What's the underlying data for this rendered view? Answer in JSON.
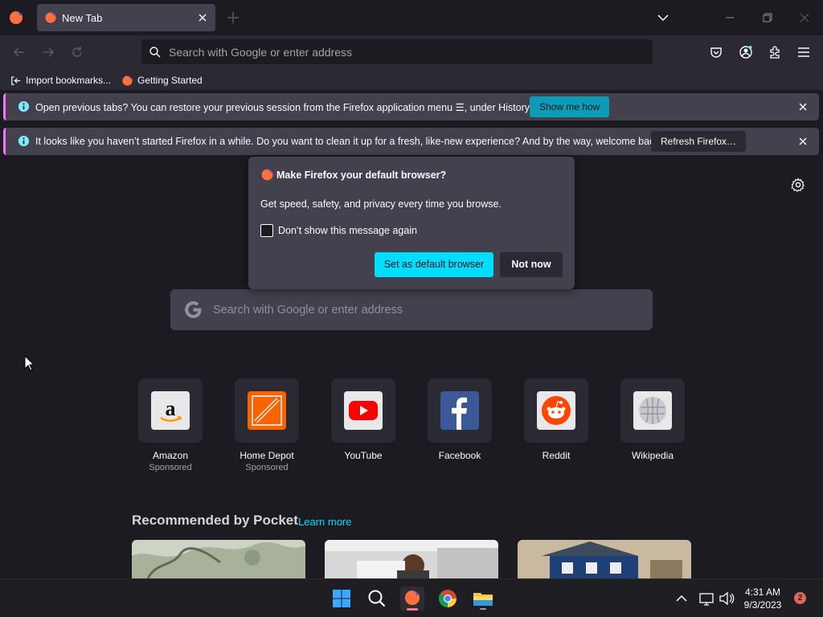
{
  "browser": {
    "tab_title": "New Tab",
    "urlbar_placeholder": "Search with Google or enter address"
  },
  "bookmarks": [
    {
      "label": "Import bookmarks..."
    },
    {
      "label": "Getting Started"
    }
  ],
  "notifications": [
    {
      "message": "Open previous tabs? You can restore your previous session from the Firefox application menu ☰, under History.",
      "button": "Show me how"
    },
    {
      "message": "It looks like you haven’t started Firefox in a while. Do you want to clean it up for a fresh, like-new experience? And by the way, welcome back!",
      "button": "Refresh Firefox…"
    }
  ],
  "popup": {
    "title": "Make Firefox your default browser?",
    "body": "Get speed, safety, and privacy every time you browse.",
    "checkbox_label": "Don’t show this message again",
    "primary_button": "Set as default browser",
    "secondary_button": "Not now"
  },
  "search": {
    "placeholder": "Search with Google or enter address"
  },
  "top_sites": [
    {
      "name": "Amazon",
      "sponsored": "Sponsored"
    },
    {
      "name": "Home Depot",
      "sponsored": "Sponsored"
    },
    {
      "name": "YouTube",
      "sponsored": ""
    },
    {
      "name": "Facebook",
      "sponsored": ""
    },
    {
      "name": "Reddit",
      "sponsored": ""
    },
    {
      "name": "Wikipedia",
      "sponsored": ""
    }
  ],
  "pocket": {
    "title": "Recommended by Pocket",
    "learn_more": "Learn more"
  },
  "taskbar": {
    "time": "4:31 AM",
    "date": "9/3/2023",
    "notification_count": "2"
  },
  "colors": {
    "accent": "#00ddff",
    "notification_accent": "#f770ff",
    "background": "#1c1b22"
  }
}
